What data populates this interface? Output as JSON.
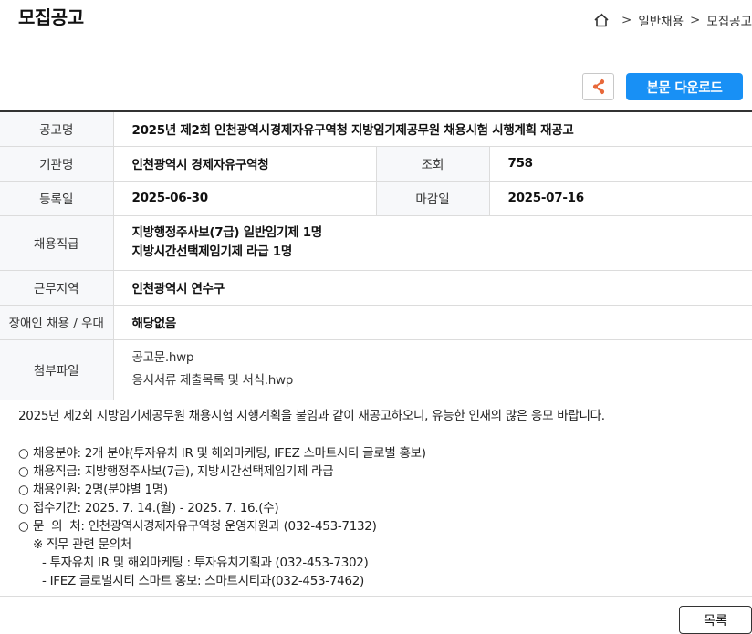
{
  "page": {
    "title": "모집공고"
  },
  "breadcrumb": {
    "items": [
      "일반채용",
      "모집공고"
    ],
    "separator": ">"
  },
  "actions": {
    "download_label": "본문 다운로드",
    "share_icon": "share-icon",
    "accent": "#1890f5",
    "share_icon_color": "#e8683a"
  },
  "info": {
    "title_label": "공고명",
    "title_value": "2025년 제2회 인천광역시경제자유구역청 지방임기제공무원 채용시험 시행계획 재공고",
    "agency_label": "기관명",
    "agency_value": "인천광역시 경제자유구역청",
    "views_label": "조회",
    "views_value": "758",
    "reg_label": "등록일",
    "reg_value": "2025-06-30",
    "deadline_label": "마감일",
    "deadline_value": "2025-07-16",
    "positions_label": "채용직급",
    "positions": [
      "지방행정주사보(7급) 일반임기제 1명",
      "지방시간선택제임기제 라급 1명"
    ],
    "location_label": "근무지역",
    "location_value": "인천광역시 연수구",
    "disabled_label": "장애인 채용 / 우대",
    "disabled_value": "해당없음",
    "files_label": "첨부파일",
    "files": [
      "공고문.hwp",
      "응시서류 제출목록 및 서식.hwp"
    ]
  },
  "content": {
    "intro": "2025년 제2회 지방임기제공무원 채용시험 시행계획을 붙임과 같이 재공고하오니, 유능한 인재의 많은 응모 바랍니다.",
    "bullet": "○",
    "items": [
      "채용분야: 2개 분야(투자유치 IR 및 해외마케팅, IFEZ 스마트시티 글로벌 홍보)",
      "채용직급: 지방행정주사보(7급), 지방시간선택제임기제 라급",
      "채용인원: 2명(분야별 1명)",
      "접수기간: 2025. 7. 14.(월) - 2025. 7. 16.(수)",
      "문  의  처: 인천광역시경제자유구역청 운영지원과 (032-453-7132)"
    ],
    "note": "※ 직무 관련 문의처",
    "contacts": [
      "- 투자유치 IR 및 해외마케팅 : 투자유치기획과 (032-453-7302)",
      "- IFEZ 글로벌시티 스마트 홍보: 스마트시티과(032-453-7462)"
    ]
  },
  "footer": {
    "list_label": "목록"
  }
}
